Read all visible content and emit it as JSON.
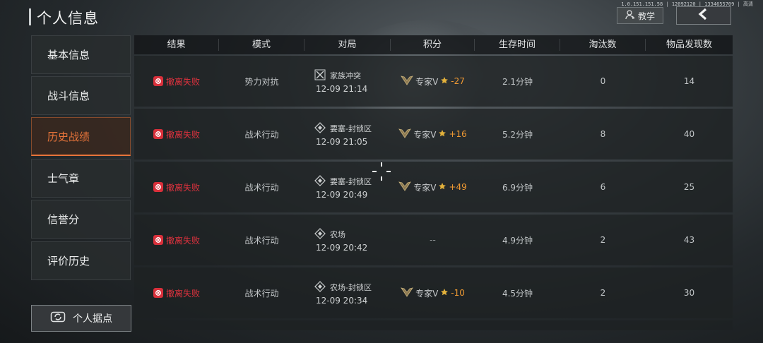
{
  "header": {
    "title": "个人信息",
    "status_text": "1.0.151.151.58 | 12092120 | 1334655709 | 高清",
    "tutorial_label": "教学"
  },
  "sidebar": {
    "items": [
      {
        "label": "基本信息"
      },
      {
        "label": "战斗信息"
      },
      {
        "label": "历史战绩"
      },
      {
        "label": "士气章"
      },
      {
        "label": "信誉分"
      },
      {
        "label": "评价历史"
      }
    ],
    "active_index": 2,
    "base_button_label": "个人据点"
  },
  "table": {
    "headers": [
      "结果",
      "模式",
      "对局",
      "积分",
      "生存时间",
      "淘汰数",
      "物品发现数"
    ],
    "rows": [
      {
        "result": "撤离失败",
        "mode": "势力对抗",
        "map": "家族冲突",
        "time": "12-09 21:14",
        "rank": "专家V",
        "delta": "-27",
        "survival": "2.1分钟",
        "kills": "0",
        "items": "14"
      },
      {
        "result": "撤离失败",
        "mode": "战术行动",
        "map": "要塞-封锁区",
        "time": "12-09 21:05",
        "rank": "专家V",
        "delta": "+16",
        "survival": "5.2分钟",
        "kills": "8",
        "items": "40"
      },
      {
        "result": "撤离失败",
        "mode": "战术行动",
        "map": "要塞-封锁区",
        "time": "12-09 20:49",
        "rank": "专家V",
        "delta": "+49",
        "survival": "6.9分钟",
        "kills": "6",
        "items": "25"
      },
      {
        "result": "撤离失败",
        "mode": "战术行动",
        "map": "农场",
        "time": "12-09 20:42",
        "rank": "",
        "delta": "",
        "score_placeholder": "--",
        "survival": "4.9分钟",
        "kills": "2",
        "items": "43"
      },
      {
        "result": "撤离失败",
        "mode": "战术行动",
        "map": "农场-封锁区",
        "time": "12-09 20:34",
        "rank": "专家V",
        "delta": "-10",
        "survival": "4.5分钟",
        "kills": "2",
        "items": "30"
      }
    ]
  },
  "colors": {
    "accent": "#e8743a",
    "fail": "#e0323e",
    "score_delta": "#f09a33"
  }
}
